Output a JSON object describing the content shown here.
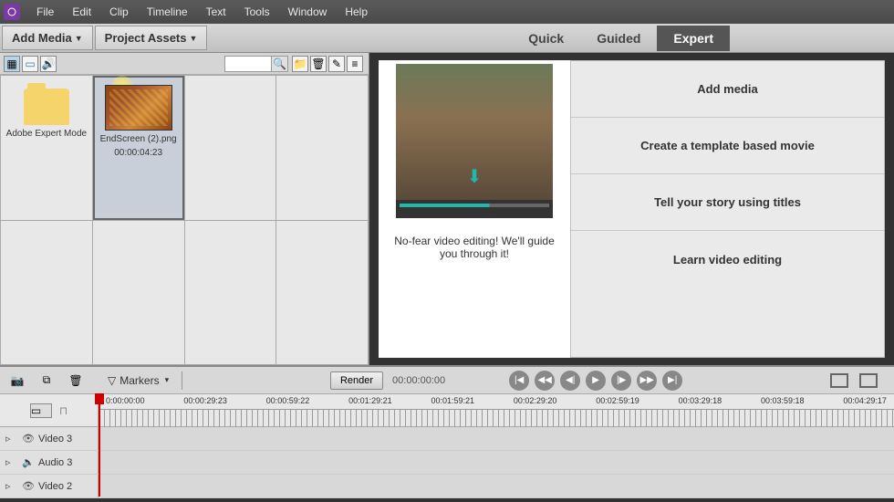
{
  "menubar": [
    "File",
    "Edit",
    "Clip",
    "Timeline",
    "Text",
    "Tools",
    "Window",
    "Help"
  ],
  "toolbar": {
    "add_media": "Add Media",
    "project_assets": "Project Assets"
  },
  "modes": {
    "quick": "Quick",
    "guided": "Guided",
    "expert": "Expert"
  },
  "assets": {
    "folder_label": "Adobe Expert Mode",
    "clip_label": "EndScreen (2).png",
    "clip_duration": "00:00:04:23"
  },
  "guided": {
    "caption": "No-fear video editing! We'll guide you through it!",
    "actions": {
      "add_media": "Add media",
      "template": "Create a template based movie",
      "titles": "Tell your story using titles",
      "learn": "Learn video editing"
    }
  },
  "timeline": {
    "markers_label": "Markers",
    "render_label": "Render",
    "timecode": "00:00:00:00",
    "ruler": [
      "0:00:00:00",
      "00:00:29:23",
      "00:00:59:22",
      "00:01:29:21",
      "00:01:59:21",
      "00:02:29:20",
      "00:02:59:19",
      "00:03:29:18",
      "00:03:59:18",
      "00:04:29:17"
    ],
    "tracks": {
      "v3": "Video 3",
      "a3": "Audio 3",
      "v2": "Video 2"
    }
  }
}
